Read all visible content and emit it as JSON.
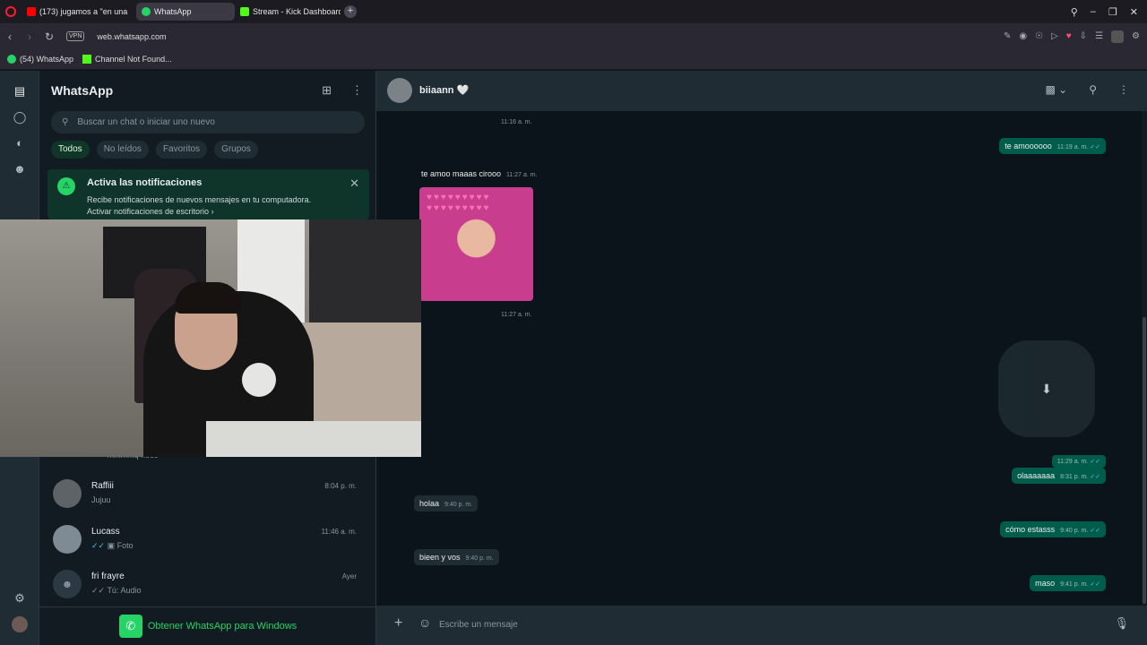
{
  "browser": {
    "tabs": [
      {
        "label": "(173) jugamos a \"en una",
        "icon_color": "#ff0000"
      },
      {
        "label": "WhatsApp",
        "icon_color": "#25d366"
      },
      {
        "label": "Stream - Kick Dashboard",
        "icon_color": "#53fc18"
      }
    ],
    "url": "web.whatsapp.com",
    "vpn_label": "VPN",
    "bookmarks": [
      {
        "label": "(54) WhatsApp"
      },
      {
        "label": "Channel Not Found..."
      }
    ]
  },
  "sidebar": {
    "title": "WhatsApp",
    "search_placeholder": "Buscar un chat o iniciar uno nuevo",
    "filters": [
      "Todos",
      "No leídos",
      "Favoritos",
      "Grupos"
    ],
    "notification": {
      "title": "Activa las notificaciones",
      "description": "Recibe notificaciones de nuevos mensajes en tu computadora.",
      "link": "Activar notificaciones de escritorio"
    },
    "chats": [
      {
        "name": "Raffiii",
        "preview": "Jujuu",
        "time": "8:04 p. m."
      },
      {
        "name": "Lucass",
        "preview": "Foto",
        "time": "11:46 a. m."
      },
      {
        "name": "fri frayre",
        "preview": "Tú: Audio",
        "time": "Ayer"
      }
    ],
    "partial_chat_preview": "mmmmq noco",
    "get_app": "Obtener WhatsApp para Windows"
  },
  "conversation": {
    "contact": "biiaann 🤍",
    "messages": [
      {
        "type": "sys",
        "text": "11:16 a. m."
      },
      {
        "type": "out",
        "text": "te amoooooo",
        "time": "11:19 a. m."
      },
      {
        "type": "in",
        "text": "te amoo maaas cirooo",
        "time": "11:27 a. m."
      },
      {
        "type": "image",
        "time": "11:27 a. m."
      },
      {
        "type": "out-time",
        "time": "11:29 a. m."
      },
      {
        "type": "out",
        "text": "olaaaaaaa",
        "time": "8:31 p. m."
      },
      {
        "type": "in",
        "text": "holaa",
        "time": "9:40 p. m."
      },
      {
        "type": "out",
        "text": "cómo estasss",
        "time": "9:40 p. m."
      },
      {
        "type": "in",
        "text": "bieen y vos",
        "time": "9:40 p. m."
      },
      {
        "type": "out",
        "text": "maso",
        "time": "9:41 p. m."
      }
    ],
    "composer_placeholder": "Escribe un mensaje"
  },
  "colors": {
    "accent": "#25d366",
    "outgoing_bubble": "#005c4b",
    "incoming_bubble": "#202c33"
  }
}
